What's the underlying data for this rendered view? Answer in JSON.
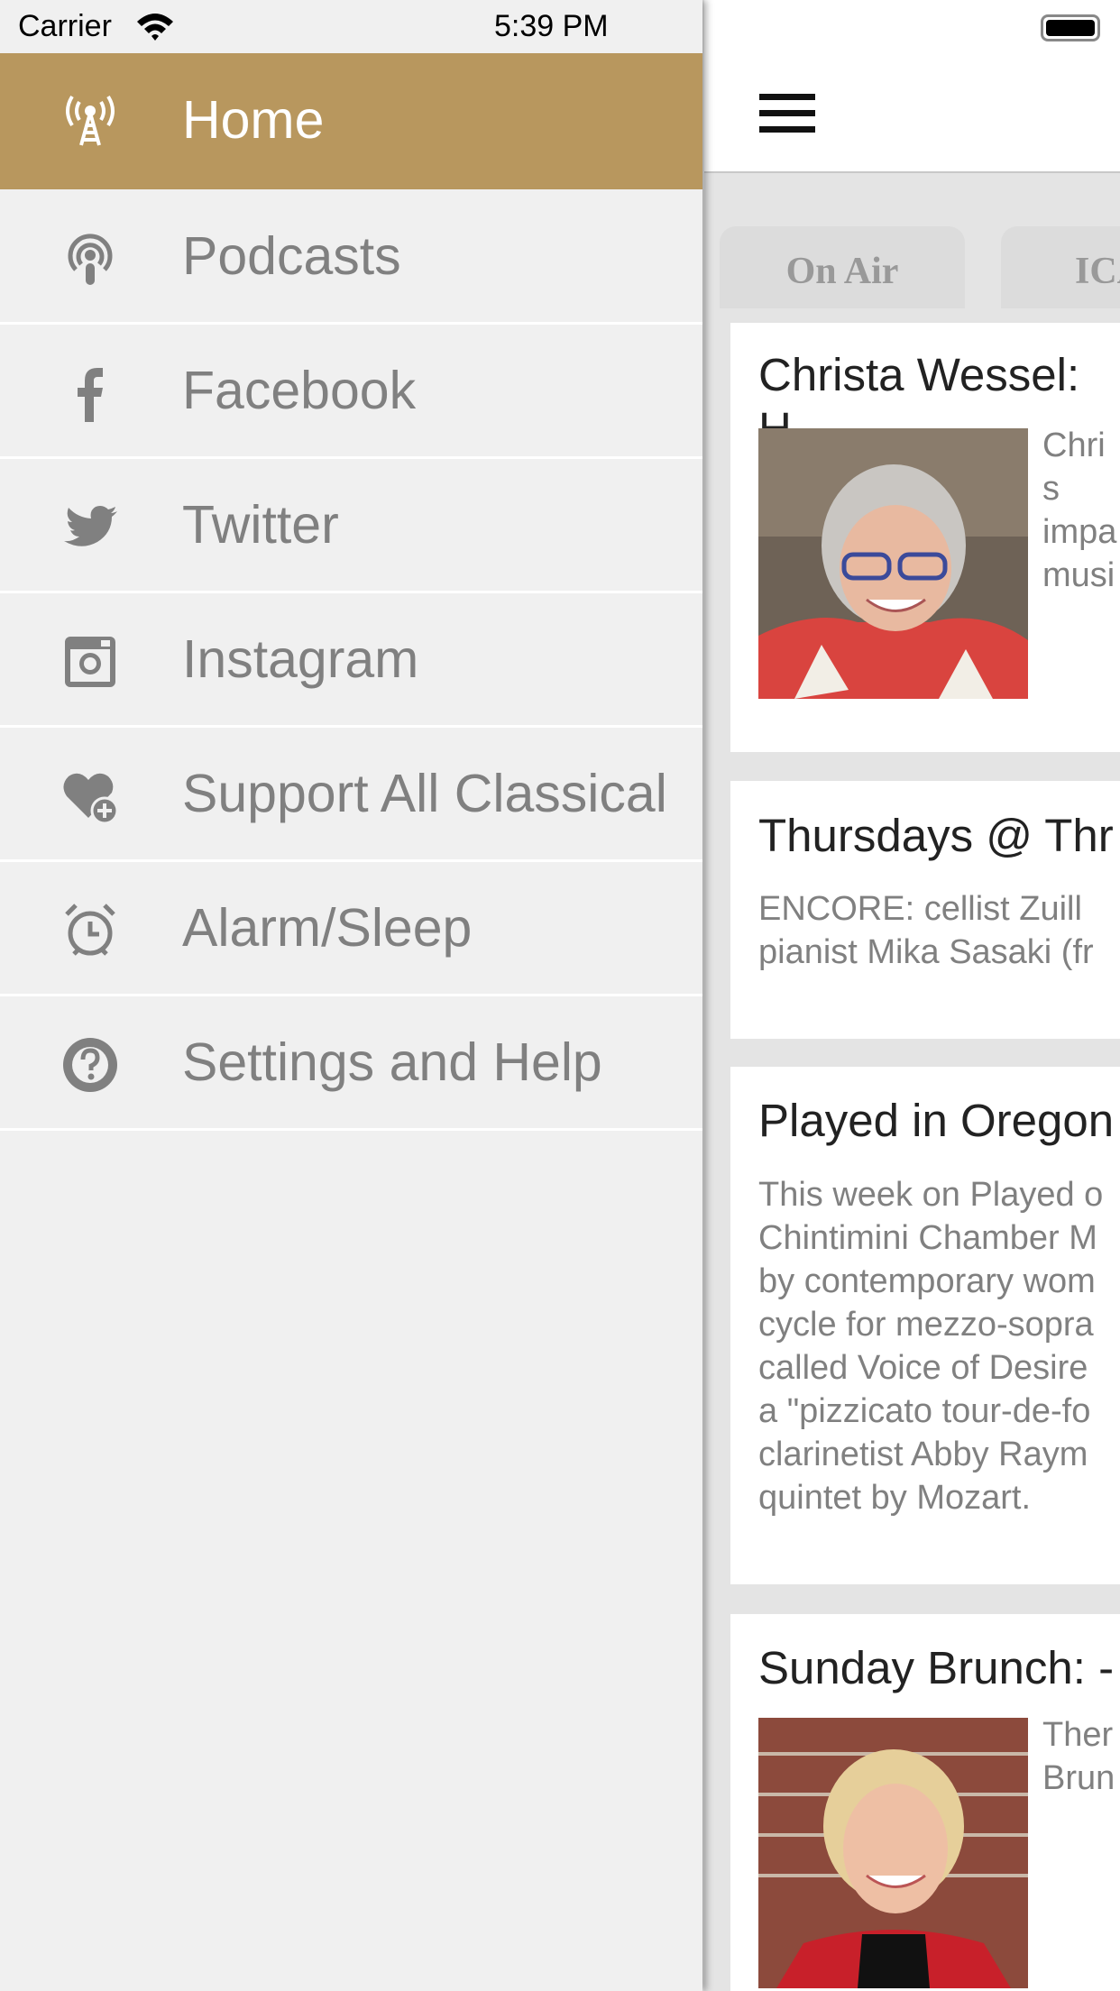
{
  "status_bar": {
    "carrier": "Carrier",
    "time": "5:39 PM"
  },
  "drawer": {
    "accent": "#B8975E",
    "items": [
      {
        "label": "Home",
        "icon": "radio-tower-icon",
        "active": true
      },
      {
        "label": "Podcasts",
        "icon": "podcast-icon"
      },
      {
        "label": "Facebook",
        "icon": "facebook-icon"
      },
      {
        "label": "Twitter",
        "icon": "twitter-icon"
      },
      {
        "label": "Instagram",
        "icon": "instagram-icon"
      },
      {
        "label": "Support All Classical",
        "icon": "heart-plus-icon"
      },
      {
        "label": "Alarm/Sleep",
        "icon": "alarm-clock-icon"
      },
      {
        "label": "Settings and Help",
        "icon": "help-circle-icon"
      }
    ]
  },
  "main": {
    "tabs": [
      {
        "label": "On Air"
      },
      {
        "label": "ICA"
      }
    ],
    "cards": [
      {
        "title": "Christa Wessel: H",
        "desc": [
          "Chris",
          "impa",
          "musi"
        ]
      },
      {
        "title": "Thursdays @ Thr",
        "desc": [
          "ENCORE: cellist Zuill",
          "pianist Mika Sasaki (fr"
        ]
      },
      {
        "title": "Played in Oregon",
        "desc": [
          "This week on Played o",
          "Chintimini Chamber M",
          "by contemporary wom",
          "cycle for mezzo-sopra",
          "called Voice of Desire",
          "a \"pizzicato tour-de-fo",
          "clarinetist Abby Raym",
          "quintet by Mozart."
        ]
      },
      {
        "title": "Sunday Brunch: -",
        "desc": [
          "Ther",
          "Brun"
        ]
      }
    ]
  }
}
